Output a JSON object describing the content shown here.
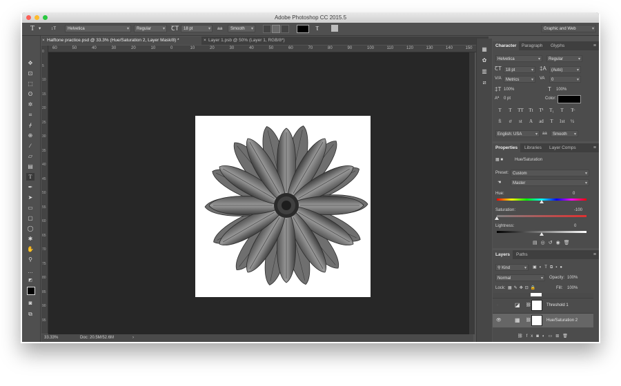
{
  "window": {
    "title": "Adobe Photoshop CC 2015.5"
  },
  "options_bar": {
    "tool_glyph": "T",
    "orient_glyph": "↕T",
    "font_family": "Helvetica",
    "font_style": "Regular",
    "font_size": "18 pt",
    "aa_label": "aa",
    "antialias": "Smooth",
    "text_color": "#000000",
    "workspace": "Graphic and Web"
  },
  "tabs": [
    {
      "label": "Halftone practice.psd @ 33.3% (Hue/Saturation 2, Layer Mask/8) *",
      "active": true
    },
    {
      "label": "Layer 1.psb @ 50% (Layer 1, RGB/8*)",
      "active": false
    }
  ],
  "ruler": {
    "top_labels": [
      "60",
      "50",
      "40",
      "30",
      "20",
      "10",
      "0",
      "10",
      "20",
      "30",
      "40",
      "50",
      "60",
      "70",
      "80",
      "90",
      "100",
      "110",
      "120",
      "130",
      "140",
      "150"
    ],
    "left_labels": [
      "0",
      "5",
      "10",
      "15",
      "20",
      "25",
      "30",
      "35",
      "40",
      "45",
      "50",
      "55",
      "60",
      "65",
      "70",
      "75",
      "80",
      "85",
      "90",
      "95"
    ]
  },
  "status": {
    "zoom": "33.33%",
    "doc": "Doc: 20.5M/52.6M",
    "arrow": "›"
  },
  "character": {
    "tabs": [
      "Character",
      "Paragraph",
      "Glyphs"
    ],
    "font_family": "Helvetica",
    "font_style": "Regular",
    "size": "18 pt",
    "leading": "(Auto)",
    "kerning": "Metrics",
    "tracking": "0",
    "vscale": "100%",
    "hscale": "100%",
    "baseline": "0 pt",
    "color_label": "Color:",
    "language": "English: USA",
    "aa_label": "aa",
    "antialias": "Smooth",
    "style_buttons": [
      "T",
      "T",
      "TT",
      "Tt",
      "T¹",
      "T₁",
      "T",
      "T̶"
    ],
    "opentype_buttons": [
      "fi",
      "ơ",
      "st",
      "A",
      "ad",
      "T",
      "1st",
      "½"
    ]
  },
  "properties": {
    "tabs": [
      "Properties",
      "Libraries",
      "Layer Comps"
    ],
    "title": "Hue/Saturation",
    "preset_label": "Preset:",
    "preset": "Custom",
    "channel": "Master",
    "hue_label": "Hue:",
    "hue": "0",
    "hue_pos": 0.5,
    "saturation_label": "Saturation:",
    "saturation": "-100",
    "saturation_pos": 0.0,
    "lightness_label": "Lightness:",
    "lightness": "0",
    "lightness_pos": 0.5
  },
  "layers": {
    "tabs": [
      "Layers",
      "Paths"
    ],
    "kind": "Kind",
    "blend": "Normal",
    "opacity_label": "Opacity:",
    "opacity": "100%",
    "lock_label": "Lock:",
    "fill_label": "Fill:",
    "fill": "100%",
    "items": [
      {
        "name": "Threshold 1"
      },
      {
        "name": "Hue/Saturation 2"
      }
    ]
  }
}
